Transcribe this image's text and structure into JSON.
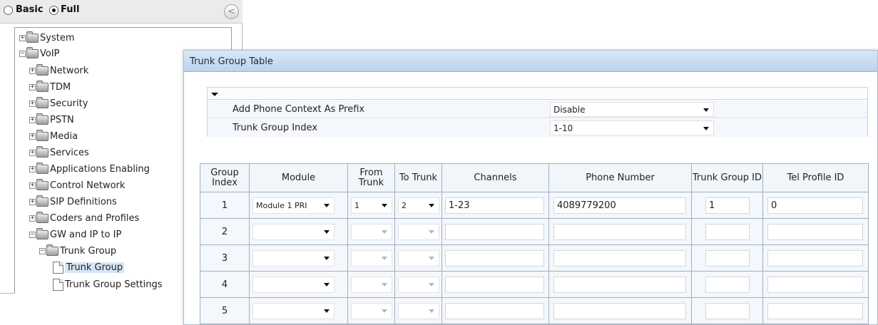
{
  "mode": {
    "basic_label": "Basic",
    "full_label": "Full",
    "selected": "Full"
  },
  "nav": {
    "collapse_glyph": "<",
    "tree": [
      {
        "label": "System",
        "expander": "+",
        "icon": "folder-icon",
        "level": 0
      },
      {
        "label": "VoIP",
        "expander": "−",
        "icon": "folder-icon",
        "level": 0
      },
      {
        "label": "Network",
        "expander": "+",
        "icon": "folder-icon",
        "level": 1
      },
      {
        "label": "TDM",
        "expander": "+",
        "icon": "folder-icon",
        "level": 1
      },
      {
        "label": "Security",
        "expander": "+",
        "icon": "folder-icon",
        "level": 1
      },
      {
        "label": "PSTN",
        "expander": "+",
        "icon": "folder-icon",
        "level": 1
      },
      {
        "label": "Media",
        "expander": "+",
        "icon": "folder-icon",
        "level": 1
      },
      {
        "label": "Services",
        "expander": "+",
        "icon": "folder-icon",
        "level": 1
      },
      {
        "label": "Applications Enabling",
        "expander": "+",
        "icon": "folder-icon",
        "level": 1
      },
      {
        "label": "Control Network",
        "expander": "+",
        "icon": "folder-icon",
        "level": 1
      },
      {
        "label": "SIP Definitions",
        "expander": "+",
        "icon": "folder-icon",
        "level": 1
      },
      {
        "label": "Coders and Profiles",
        "expander": "+",
        "icon": "folder-icon",
        "level": 1
      },
      {
        "label": "GW and IP to IP",
        "expander": "−",
        "icon": "folder-icon",
        "level": 1
      },
      {
        "label": "Trunk Group",
        "expander": "−",
        "icon": "folder-icon",
        "level": 2
      },
      {
        "label": "Trunk Group",
        "expander": "",
        "icon": "page-icon",
        "level": 3,
        "selected": true
      },
      {
        "label": "Trunk Group Settings",
        "expander": "",
        "icon": "page-icon",
        "level": 3
      }
    ]
  },
  "panel": {
    "title": "Trunk Group Table",
    "params": [
      {
        "label": "Add Phone Context As Prefix",
        "value": "Disable"
      },
      {
        "label": "Trunk Group Index",
        "value": "1-10"
      }
    ]
  },
  "table": {
    "headers": [
      "Group Index",
      "Module",
      "From Trunk",
      "To Trunk",
      "Channels",
      "Phone Number",
      "Trunk Group ID",
      "Tel Profile ID"
    ],
    "rows": [
      {
        "index": "1",
        "module": "Module 1 PRI",
        "from_trunk": "1",
        "to_trunk": "2",
        "channels": "1-23",
        "phone": "4089779200",
        "trunk_group_id": "1",
        "tel_profile_id": "0"
      },
      {
        "index": "2",
        "module": "",
        "from_trunk": "",
        "to_trunk": "",
        "channels": "",
        "phone": "",
        "trunk_group_id": "",
        "tel_profile_id": ""
      },
      {
        "index": "3",
        "module": "",
        "from_trunk": "",
        "to_trunk": "",
        "channels": "",
        "phone": "",
        "trunk_group_id": "",
        "tel_profile_id": ""
      },
      {
        "index": "4",
        "module": "",
        "from_trunk": "",
        "to_trunk": "",
        "channels": "",
        "phone": "",
        "trunk_group_id": "",
        "tel_profile_id": ""
      },
      {
        "index": "5",
        "module": "",
        "from_trunk": "",
        "to_trunk": "",
        "channels": "",
        "phone": "",
        "trunk_group_id": "",
        "tel_profile_id": ""
      }
    ]
  },
  "colors": {
    "title_bar": "#c8dcf2",
    "row_bg": "#f4f7fb",
    "border": "#9fb0c4",
    "selected_bg": "#d6e6f5"
  }
}
